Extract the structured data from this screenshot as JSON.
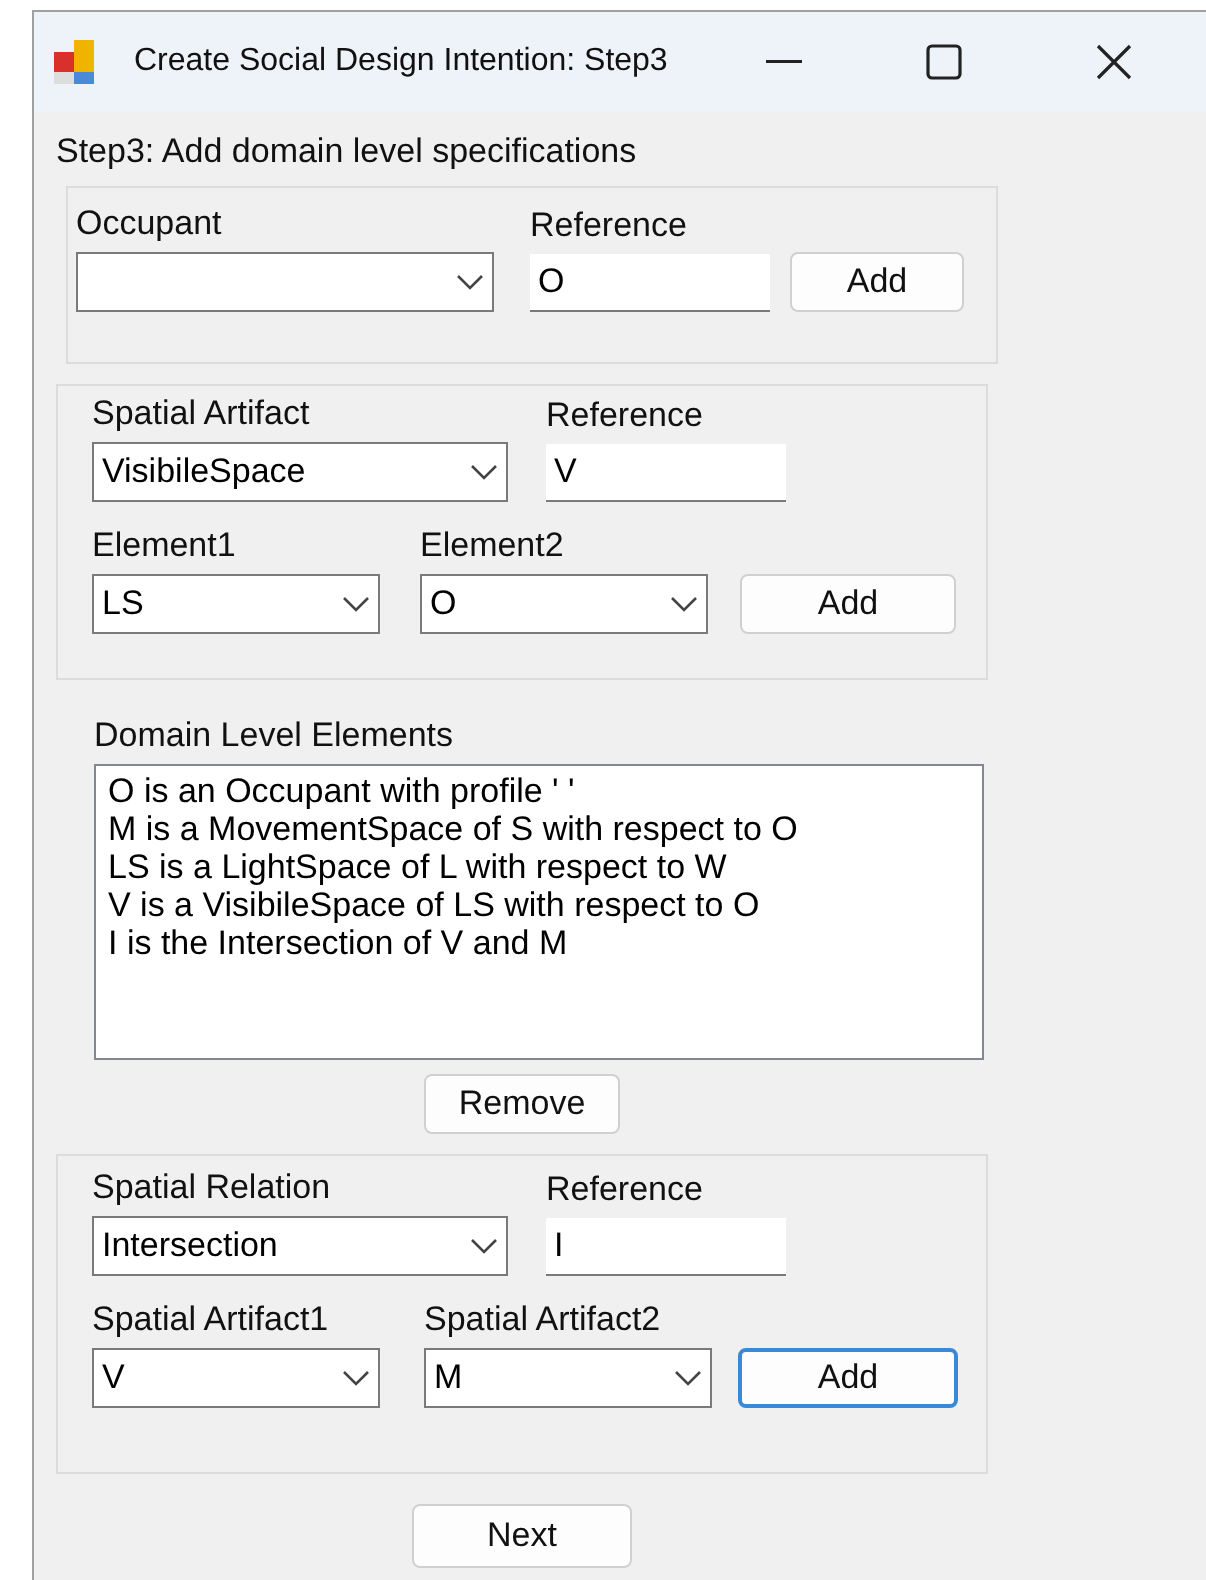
{
  "window": {
    "title": "Create Social Design Intention: Step3"
  },
  "step_label": "Step3: Add domain level specifications",
  "occupant_group": {
    "occupant_label": "Occupant",
    "reference_label": "Reference",
    "reference_value": "O",
    "add_button": {
      "label": "Add",
      "focused": false
    }
  },
  "artifact_group": {
    "artifact_label": "Spatial Artifact",
    "artifact_value": "VisibileSpace",
    "reference_label": "Reference",
    "reference_value": "V",
    "element1_label": "Element1",
    "element1_value": "LS",
    "element2_label": "Element2",
    "element2_value": "O",
    "add_button": {
      "label": "Add",
      "focused": false
    }
  },
  "domain_elements": {
    "label": "Domain Level Elements",
    "items": [
      "O is an Occupant with profile ' '",
      "M is a MovementSpace of S with respect to O",
      "LS is a LightSpace of L with respect to W",
      "V is a VisibileSpace of LS with respect to O",
      "I is the Intersection of V and M"
    ],
    "remove_button": "Remove"
  },
  "relation_group": {
    "relation_label": "Spatial Relation",
    "relation_value": "Intersection",
    "reference_label": "Reference",
    "reference_value": "I",
    "artifact1_label": "Spatial Artifact1",
    "artifact1_value": "V",
    "artifact2_label": "Spatial Artifact2",
    "artifact2_value": "M",
    "add_button": {
      "label": "Add",
      "focused": true
    }
  },
  "next_button": "Next"
}
